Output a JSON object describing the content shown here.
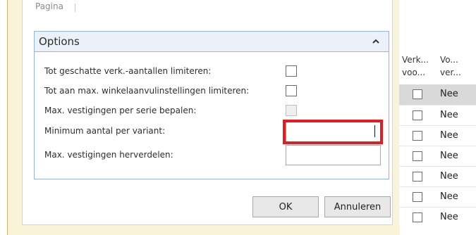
{
  "dialog": {
    "top_tab": "Pagina",
    "options": {
      "title": "Options",
      "rows": [
        {
          "label": "Tot geschatte verk.-aantallen limiteren:"
        },
        {
          "label": "Tot aan max. winkelaanvulinstellingen limiteren:"
        },
        {
          "label": "Max. vestigingen per serie bepalen:"
        },
        {
          "label": "Minimum aantal per variant:"
        },
        {
          "label": "Max. vestigingen herverdelen:"
        }
      ]
    },
    "buttons": {
      "ok": "OK",
      "cancel": "Annuleren"
    }
  },
  "background_grid": {
    "columns": [
      "Verk... voo...",
      "Vo... ver..."
    ],
    "column_lines": [
      [
        "Verk...",
        "voo..."
      ],
      [
        "Vo...",
        "ver..."
      ]
    ],
    "rows": [
      "Nee",
      "Nee",
      "Nee",
      "Nee",
      "Nee",
      "Nee",
      "Nee"
    ]
  },
  "colors": {
    "highlight": "#e31b23",
    "options_border": "#90b8d9",
    "dialog_bg": "#fbf3d7"
  }
}
